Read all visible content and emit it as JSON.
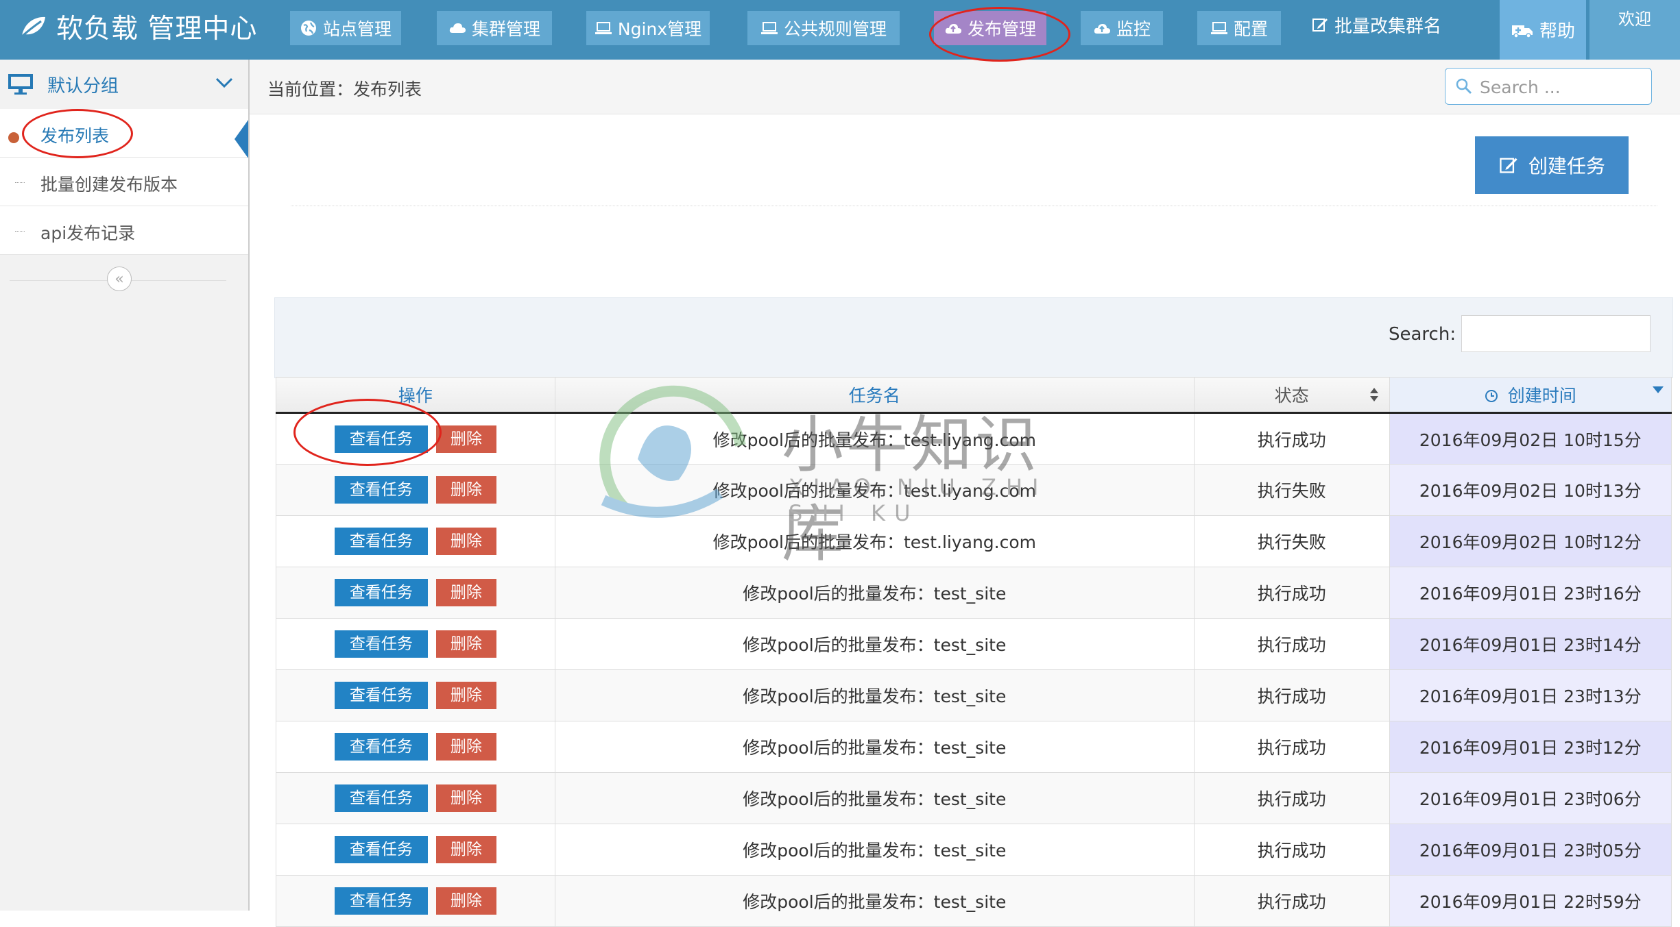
{
  "brand": {
    "title": "软负载 管理中心",
    "icon": "leaf-icon"
  },
  "nav": {
    "items": [
      {
        "label": "站点管理",
        "icon": "globe-icon"
      },
      {
        "label": "集群管理",
        "icon": "cloud-icon"
      },
      {
        "label": "Nginx管理",
        "icon": "laptop-icon"
      },
      {
        "label": "公共规则管理",
        "icon": "laptop-icon"
      },
      {
        "label": "发布管理",
        "icon": "cloud-upload-icon",
        "active": true
      },
      {
        "label": "监控",
        "icon": "cloud-upload-icon"
      },
      {
        "label": "配置",
        "icon": "laptop-icon"
      },
      {
        "label": "批量改集群名",
        "icon": "edit-icon"
      }
    ],
    "help": "帮助",
    "welcome": "欢迎"
  },
  "sidebar": {
    "group": "默认分组",
    "items": [
      {
        "label": "发布列表",
        "active": true
      },
      {
        "label": "批量创建发布版本"
      },
      {
        "label": "api发布记录"
      }
    ],
    "collapse_icon": "«"
  },
  "breadcrumb": "当前位置：发布列表",
  "search": {
    "placeholder": "Search ..."
  },
  "create_button": "创建任务",
  "table": {
    "search_label": "Search:",
    "columns": [
      "操作",
      "任务名",
      "状态",
      "创建时间"
    ],
    "view_label": "查看任务",
    "delete_label": "删除",
    "rows": [
      {
        "name": "修改pool后的批量发布：test.liyang.com",
        "status": "执行成功",
        "status_type": "ok",
        "time": "2016年09月02日 10时15分"
      },
      {
        "name": "修改pool后的批量发布：test.liyang.com",
        "status": "执行失败",
        "status_type": "fail",
        "time": "2016年09月02日 10时13分"
      },
      {
        "name": "修改pool后的批量发布：test.liyang.com",
        "status": "执行失败",
        "status_type": "fail",
        "time": "2016年09月02日 10时12分"
      },
      {
        "name": "修改pool后的批量发布：test_site",
        "status": "执行成功",
        "status_type": "ok",
        "time": "2016年09月01日 23时16分"
      },
      {
        "name": "修改pool后的批量发布：test_site",
        "status": "执行成功",
        "status_type": "ok",
        "time": "2016年09月01日 23时14分"
      },
      {
        "name": "修改pool后的批量发布：test_site",
        "status": "执行成功",
        "status_type": "ok",
        "time": "2016年09月01日 23时13分"
      },
      {
        "name": "修改pool后的批量发布：test_site",
        "status": "执行成功",
        "status_type": "ok",
        "time": "2016年09月01日 23时12分"
      },
      {
        "name": "修改pool后的批量发布：test_site",
        "status": "执行成功",
        "status_type": "ok",
        "time": "2016年09月01日 23时06分"
      },
      {
        "name": "修改pool后的批量发布：test_site",
        "status": "执行成功",
        "status_type": "ok",
        "time": "2016年09月01日 23时05分"
      },
      {
        "name": "修改pool后的批量发布：test_site",
        "status": "执行成功",
        "status_type": "ok",
        "time": "2016年09月01日 22时59分"
      }
    ]
  },
  "watermark": {
    "title": "小牛知识库",
    "subtitle": "XIAO NIU ZHI SHI KU"
  },
  "colors": {
    "topbar": "#438eb9",
    "nav_button": "#62a8d1",
    "nav_active": "#a485c7",
    "primary": "#428bca",
    "danger": "#d15b47",
    "success": "#1a8a1a",
    "fail": "#d51b1b",
    "annotation": "#e0241c"
  }
}
